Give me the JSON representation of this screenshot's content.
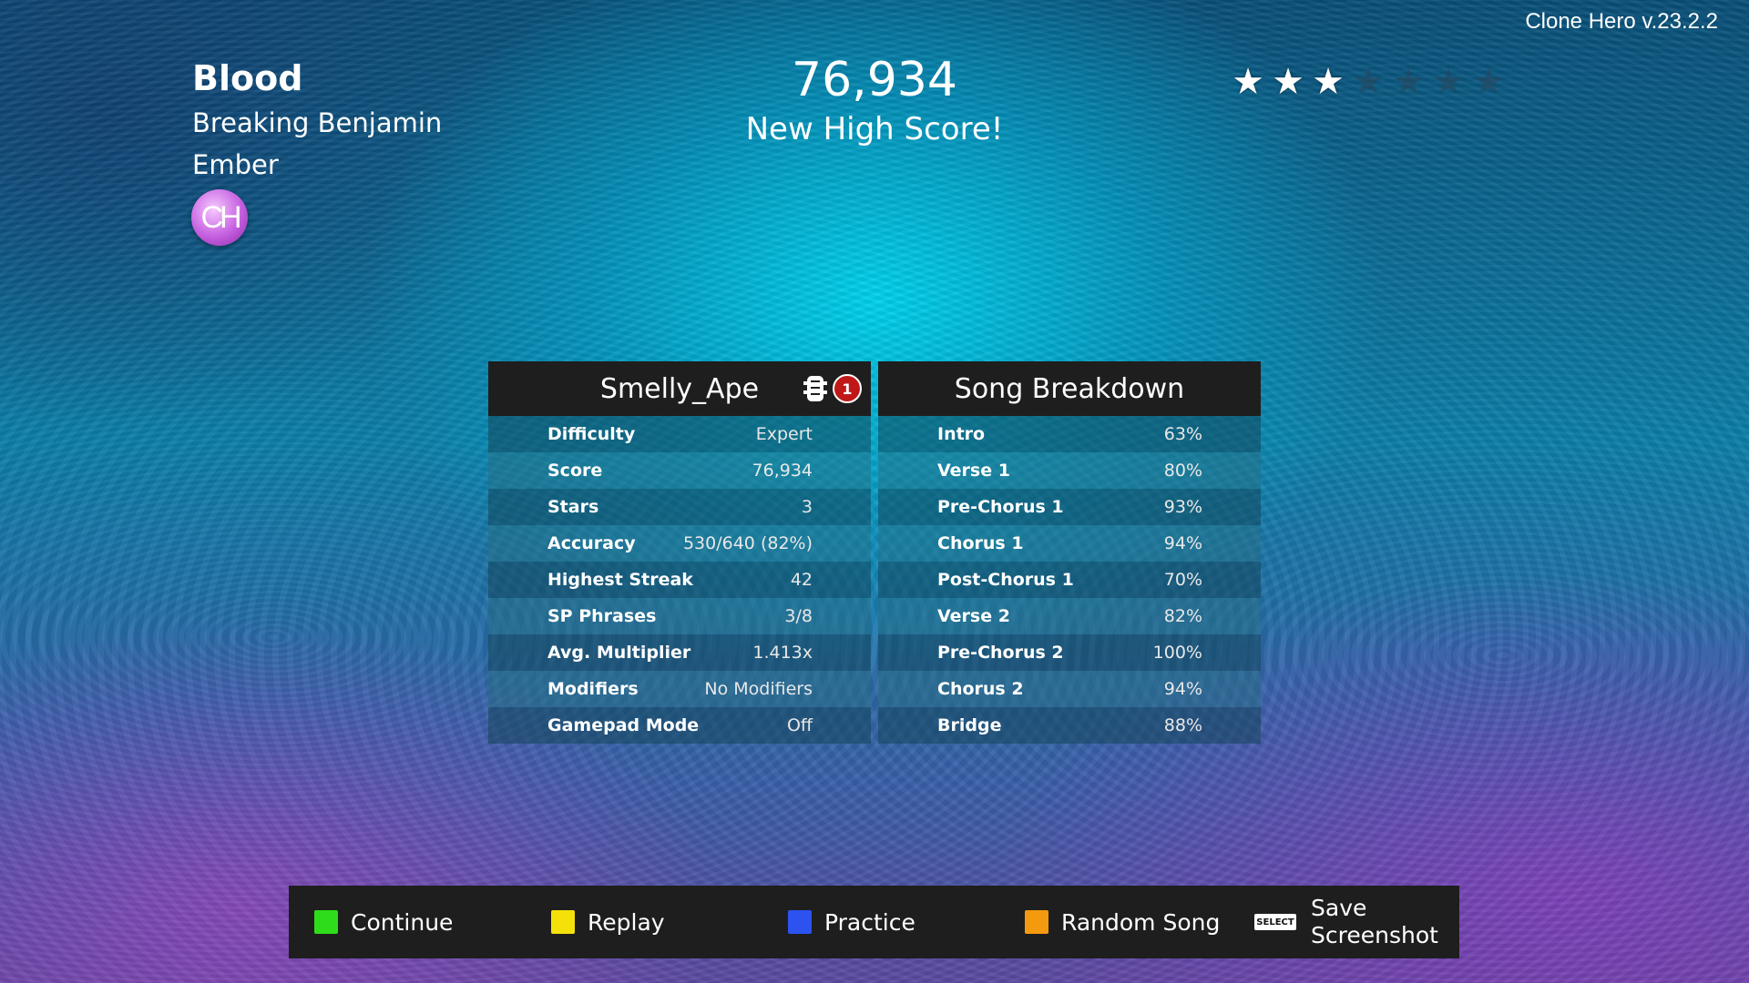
{
  "app": {
    "version": "Clone Hero v.23.2.2"
  },
  "song": {
    "title": "Blood",
    "artist": "Breaking Benjamin",
    "charter": "Ember",
    "logo_text": "CH"
  },
  "results": {
    "score": "76,934",
    "message": "New High Score!",
    "stars": 3,
    "max_stars": 7
  },
  "player_panel": {
    "name": "Smelly_Ape",
    "rank_badge": "1",
    "instrument_icon": "guitar-icon",
    "rows": [
      {
        "label": "Difficulty",
        "value": "Expert"
      },
      {
        "label": "Score",
        "value": "76,934"
      },
      {
        "label": "Stars",
        "value": "3"
      },
      {
        "label": "Accuracy",
        "value": "530/640 (82%)"
      },
      {
        "label": "Highest Streak",
        "value": "42"
      },
      {
        "label": "SP Phrases",
        "value": "3/8"
      },
      {
        "label": "Avg. Multiplier",
        "value": "1.413x"
      },
      {
        "label": "Modifiers",
        "value": "No Modifiers"
      },
      {
        "label": "Gamepad Mode",
        "value": "Off"
      }
    ]
  },
  "breakdown_panel": {
    "title": "Song Breakdown",
    "rows": [
      {
        "label": "Intro",
        "value": "63%"
      },
      {
        "label": "Verse 1",
        "value": "80%"
      },
      {
        "label": "Pre-Chorus 1",
        "value": "93%"
      },
      {
        "label": "Chorus 1",
        "value": "94%"
      },
      {
        "label": "Post-Chorus 1",
        "value": "70%"
      },
      {
        "label": "Verse 2",
        "value": "82%"
      },
      {
        "label": "Pre-Chorus 2",
        "value": "100%"
      },
      {
        "label": "Chorus 2",
        "value": "94%"
      },
      {
        "label": "Bridge",
        "value": "88%"
      }
    ]
  },
  "actions": {
    "continue": {
      "label": "Continue",
      "color": "#2fdc1a"
    },
    "replay": {
      "label": "Replay",
      "color": "#f4e10a"
    },
    "practice": {
      "label": "Practice",
      "color": "#2c52f0"
    },
    "random": {
      "label": "Random Song",
      "color": "#f59a0e"
    },
    "screenshot": {
      "label_line1": "Save",
      "label_line2": "Screenshot",
      "button_text": "SELECT"
    }
  }
}
